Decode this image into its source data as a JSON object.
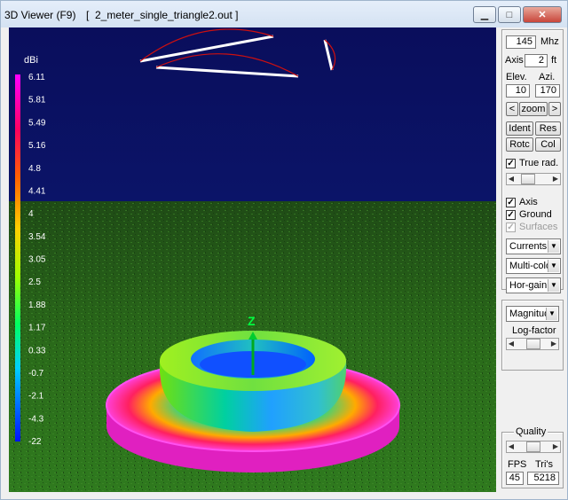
{
  "window": {
    "title": "3D Viewer (F9)",
    "file": "[  2_meter_single_triangle2.out ]",
    "controls": {
      "minimize": "▁",
      "maximize": "□",
      "close": "✕"
    }
  },
  "legend": {
    "unit": "dBi",
    "ticks": [
      "6.11",
      "5.81",
      "5.49",
      "5.16",
      "4.8",
      "4.41",
      "4",
      "3.54",
      "3.05",
      "2.5",
      "1.88",
      "1.17",
      "0.33",
      "-0.7",
      "-2.1",
      "-4.3",
      "-22"
    ]
  },
  "axis_label": "Z",
  "panel": {
    "freq_value": "145",
    "freq_unit": "Mhz",
    "axis_label": "Axis",
    "axis_value": "2",
    "axis_unit": "ft",
    "elev_label": "Elev.",
    "azi_label": "Azi.",
    "elev_value": "10",
    "azi_value": "170",
    "zoom_left": "<",
    "zoom_label": "zoom",
    "zoom_right": ">",
    "ident_label": "Ident",
    "res_label": "Res",
    "rotc_label": "Rotc",
    "col_label": "Col",
    "truerad_label": "True rad.",
    "axis_check_label": "Axis",
    "ground_label": "Ground",
    "surfaces_label": "Surfaces",
    "currents_value": "Currents",
    "color_value": "Multi-colo",
    "gain_value": "Hor-gain",
    "magnitude_value": "Magnitud",
    "logfactor_label": "Log-factor",
    "quality_label": "Quality",
    "fps_label": "FPS",
    "tris_label": "Tri's",
    "fps_value": "45",
    "tris_value": "5218",
    "check_mark": "✓",
    "dd_arrow": "▼",
    "slider_left": "◀",
    "slider_right": "▶"
  }
}
